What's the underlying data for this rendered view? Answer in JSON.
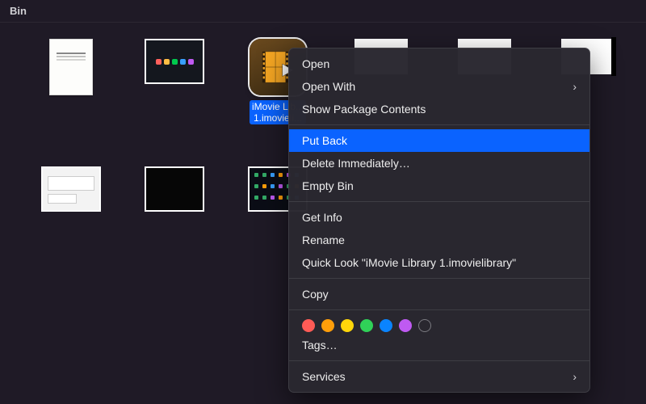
{
  "window": {
    "title": "Bin"
  },
  "selected_file": {
    "label": "iMovie Library 1.imovielibrary",
    "truncated_label": "iMovie Lib...\n1.imovieli..."
  },
  "context_menu": {
    "open": "Open",
    "open_with": "Open With",
    "show_package": "Show Package Contents",
    "put_back": "Put Back",
    "delete_immediately": "Delete Immediately…",
    "empty_bin": "Empty Bin",
    "get_info": "Get Info",
    "rename": "Rename",
    "quick_look": "Quick Look \"iMovie Library 1.imovielibrary\"",
    "copy": "Copy",
    "tags": "Tags…",
    "services": "Services"
  },
  "tag_colors": [
    "#ff5b56",
    "#ff9e0a",
    "#ffd60a",
    "#30d158",
    "#0a84ff",
    "#bf5af2"
  ]
}
